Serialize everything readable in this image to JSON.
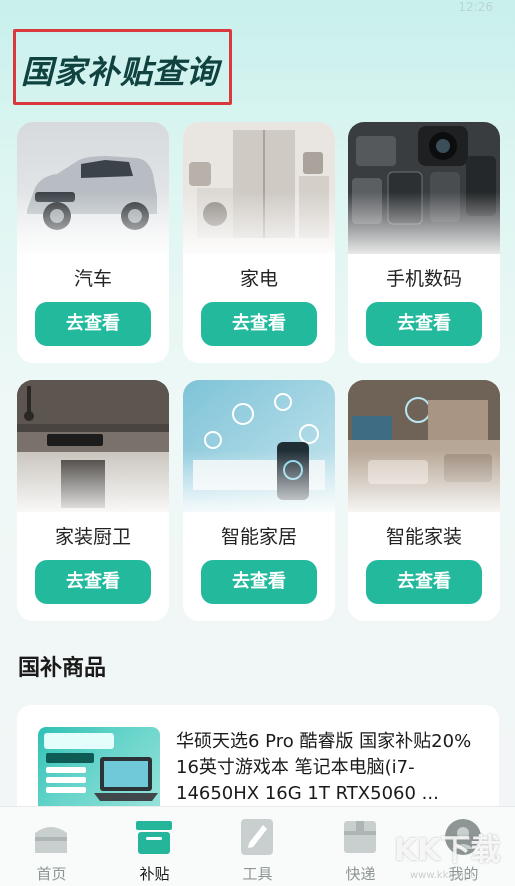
{
  "page": {
    "title": "国家补贴查询",
    "status_time": "12:26"
  },
  "categories": [
    {
      "label": "汽车",
      "button": "去查看",
      "image": "car"
    },
    {
      "label": "家电",
      "button": "去查看",
      "image": "appliances"
    },
    {
      "label": "手机数码",
      "button": "去查看",
      "image": "digital"
    },
    {
      "label": "家装厨卫",
      "button": "去查看",
      "image": "kitchen"
    },
    {
      "label": "智能家居",
      "button": "去查看",
      "image": "smart-home"
    },
    {
      "label": "智能家装",
      "button": "去查看",
      "image": "smart-decor"
    }
  ],
  "products_section": {
    "title": "国补商品",
    "items": [
      {
        "title": "华硕天选6 Pro 酷睿版 国家补贴20% 16英寸游戏本 笔记本电脑(i7-14650HX 16G 1T RTX5060 ...",
        "image": "laptop-promo"
      }
    ]
  },
  "tabbar": {
    "tabs": [
      {
        "label": "首页",
        "icon": "home-icon",
        "active": false
      },
      {
        "label": "补贴",
        "icon": "subsidy-box-icon",
        "active": true
      },
      {
        "label": "工具",
        "icon": "tool-pen-icon",
        "active": false
      },
      {
        "label": "快递",
        "icon": "package-icon",
        "active": false
      },
      {
        "label": "我的",
        "icon": "profile-icon",
        "active": false
      }
    ]
  },
  "watermark": {
    "text": "KK下载",
    "url": "www.kkx.net"
  },
  "colors": {
    "accent": "#23b99c",
    "title": "#10433f",
    "highlight_border": "#d9393b"
  }
}
